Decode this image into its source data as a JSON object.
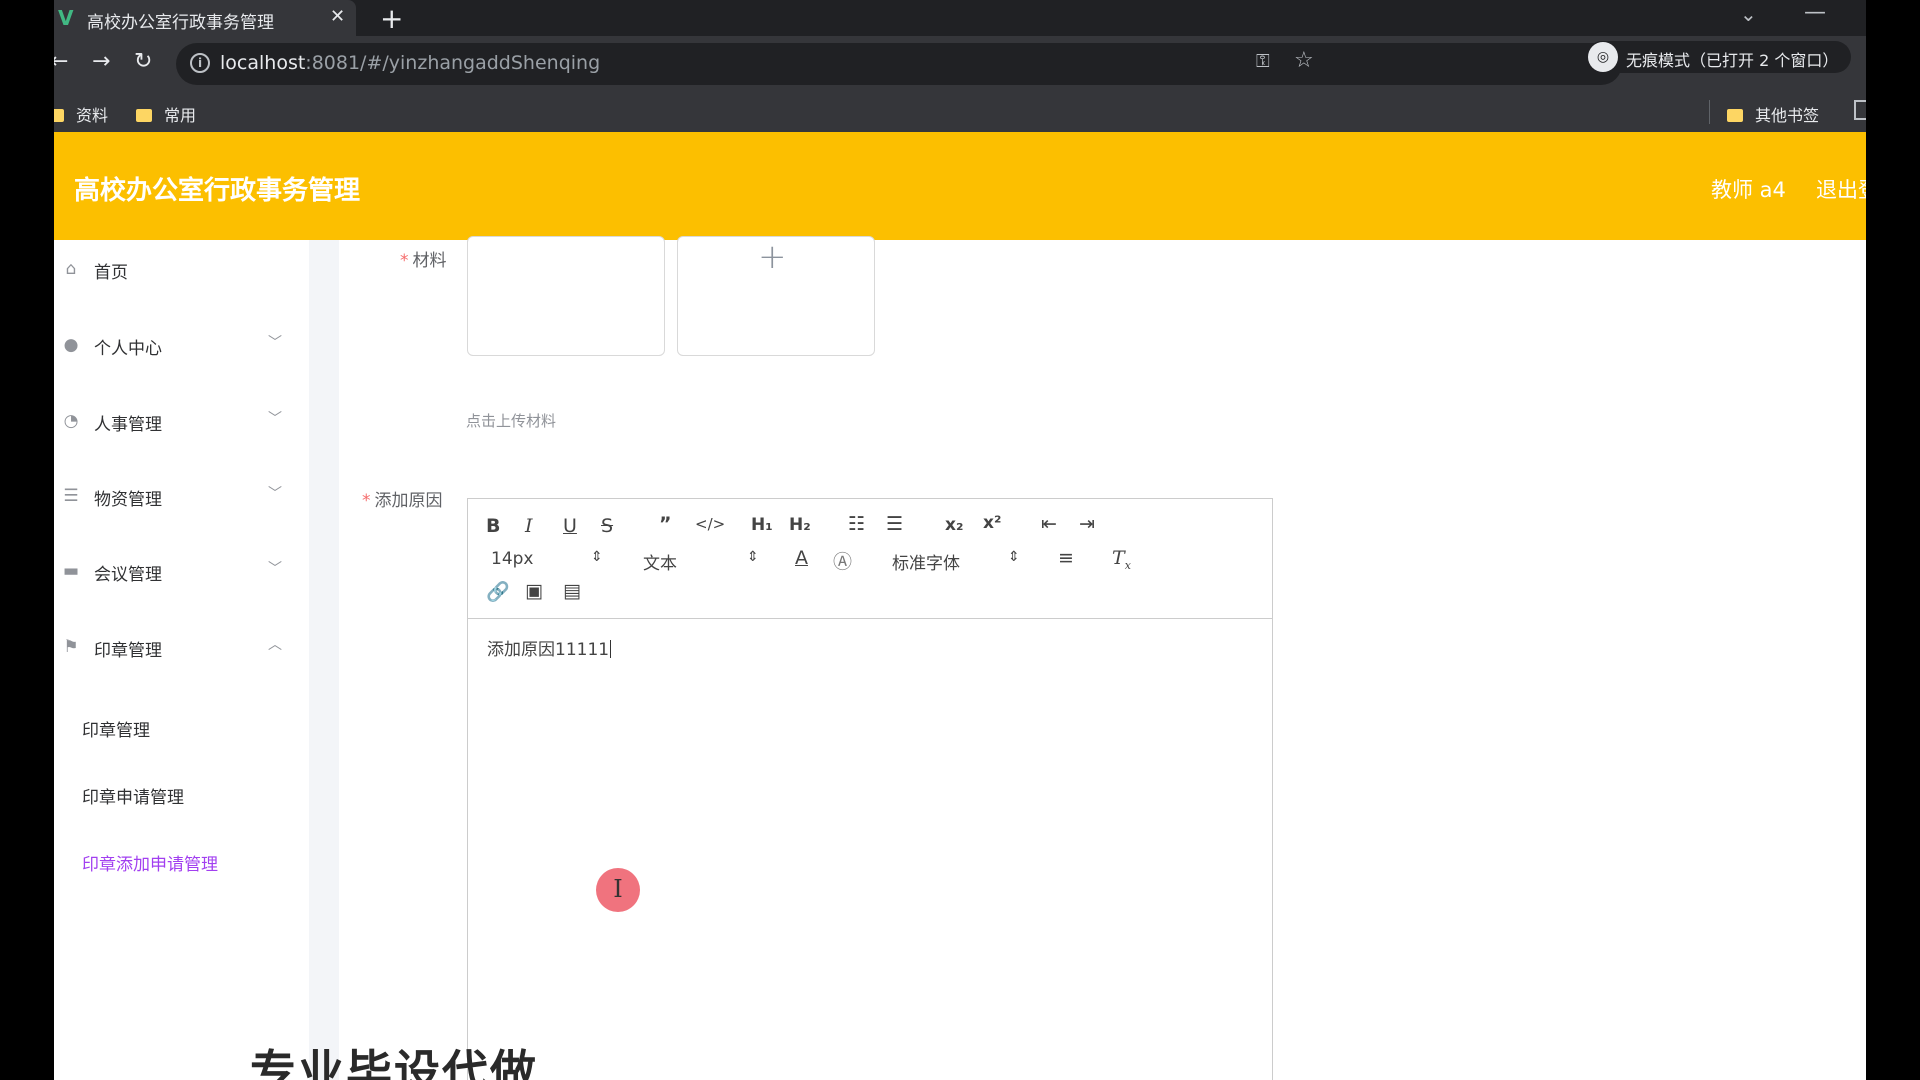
{
  "browser": {
    "tab_title": "高校办公室行政事务管理",
    "tab_favicon": "V",
    "url_host": "localhost",
    "url_path": ":8081/#/yinzhangaddShenqing",
    "incognito_label": "无痕模式（已打开 2 个窗口）",
    "bookmarks": [
      "资料",
      "常用"
    ],
    "other_bookmarks": "其他书签"
  },
  "header": {
    "title": "高校办公室行政事务管理",
    "user": "教师 a4",
    "logout": "退出登录",
    "bg_color": "#fcbf00"
  },
  "sidebar": {
    "items": [
      {
        "label": "首页",
        "icon": "home-icon"
      },
      {
        "label": "个人中心",
        "icon": "user-icon"
      },
      {
        "label": "人事管理",
        "icon": "gauge-icon"
      },
      {
        "label": "物资管理",
        "icon": "list-icon"
      },
      {
        "label": "会议管理",
        "icon": "meeting-icon"
      },
      {
        "label": "印章管理",
        "icon": "flag-icon"
      }
    ],
    "sub_items": [
      "印章管理",
      "印章申请管理",
      "印章添加申请管理"
    ],
    "active_color": "#a23ff0"
  },
  "form": {
    "material_label": "材料",
    "upload_hint": "点击上传材料",
    "reason_label": "添加原因",
    "editor": {
      "font_size": "14px",
      "heading": "文本",
      "font_family": "标准字体",
      "content": "添加原因11111"
    }
  },
  "overlay": {
    "watermark": "专业毕设代做"
  }
}
